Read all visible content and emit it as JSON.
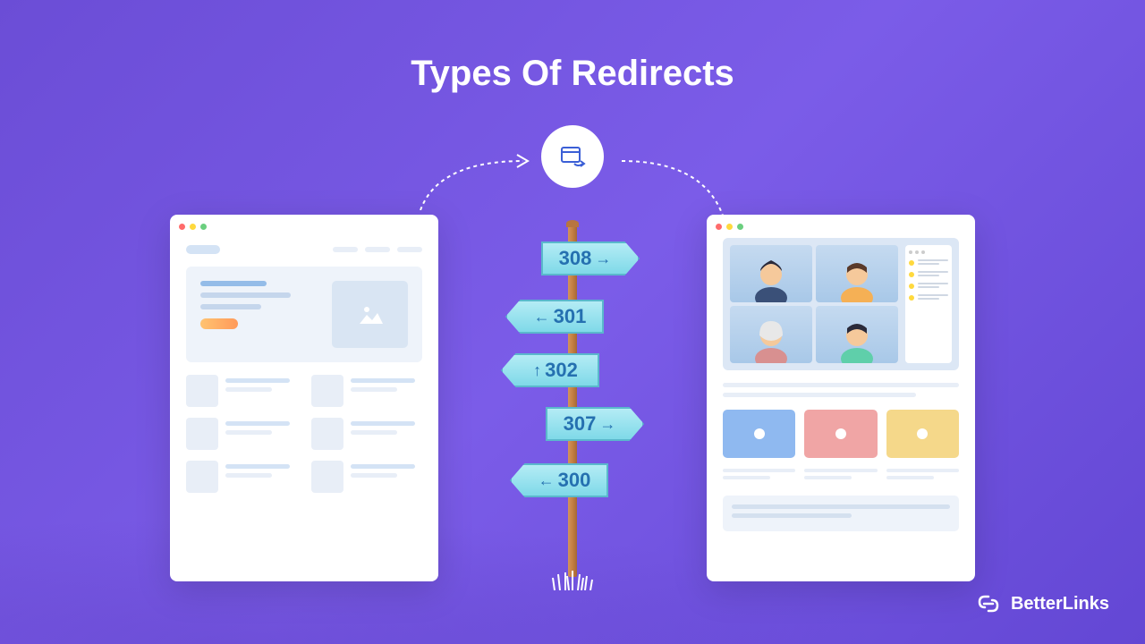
{
  "title": "Types Of Redirects",
  "signs": [
    {
      "code": "308",
      "direction": "right"
    },
    {
      "code": "301",
      "direction": "left"
    },
    {
      "code": "302",
      "direction": "left"
    },
    {
      "code": "307",
      "direction": "right"
    },
    {
      "code": "300",
      "direction": "left"
    }
  ],
  "brand": "BetterLinks"
}
